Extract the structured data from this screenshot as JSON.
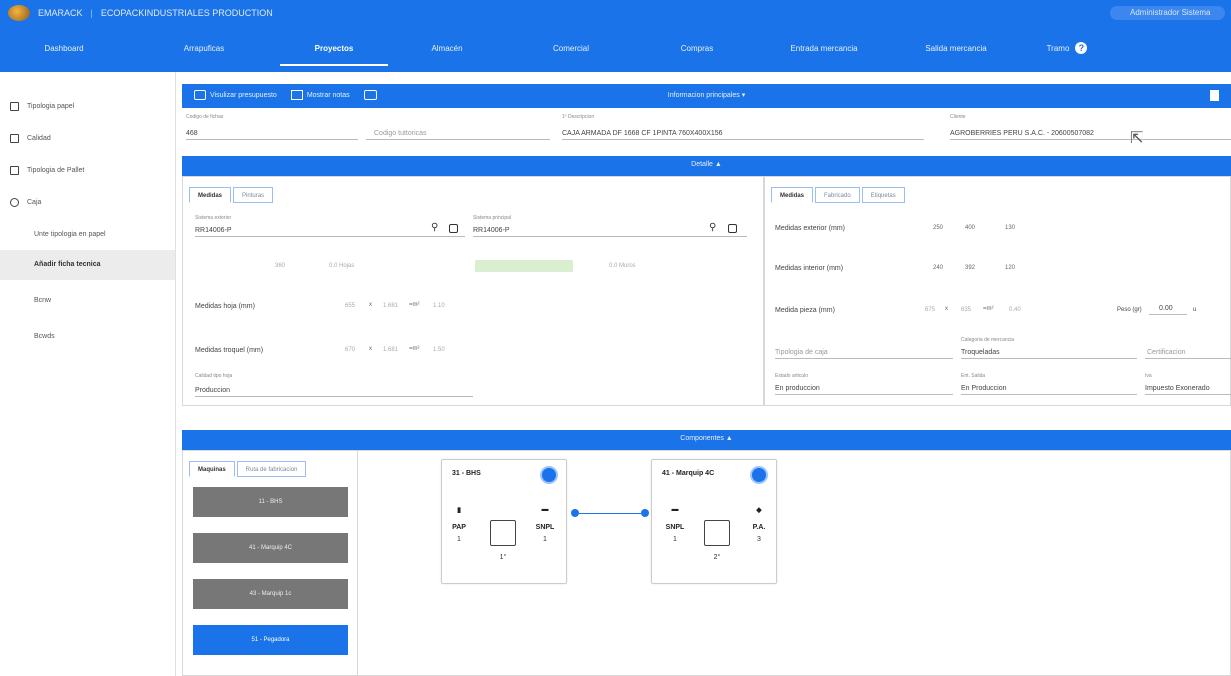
{
  "app": {
    "brand_text": "EMARACK",
    "brand_sub": "ECOPACKINDUSTRIALES PRODUCTION",
    "user_label": "Administrador Sistema"
  },
  "nav": {
    "items": [
      {
        "label": "Dashboard",
        "active": false
      },
      {
        "label": "Arrapuficas",
        "active": false
      },
      {
        "label": "Proyectos",
        "active": true
      },
      {
        "label": "Almacén",
        "active": false
      },
      {
        "label": "Comercial",
        "active": false
      },
      {
        "label": "Compras",
        "active": false
      },
      {
        "label": "Entrada mercancia",
        "active": false
      },
      {
        "label": "Salida mercancia",
        "active": false
      },
      {
        "label": "Tramo",
        "active": false
      }
    ]
  },
  "sidebar": {
    "items": [
      {
        "label": "Tipologia papel",
        "icon": "square-icon"
      },
      {
        "label": "Calidad",
        "icon": "grid-icon"
      },
      {
        "label": "Tipologia de Pallet",
        "icon": "list-icon"
      },
      {
        "label": "Caja",
        "icon": "gear-icon"
      }
    ],
    "subitems": [
      {
        "label": "Unte tipologia en papel",
        "active": false
      },
      {
        "label": "Añadir ficha tecnica",
        "active": true
      },
      {
        "label": "Bcnw",
        "active": false
      },
      {
        "label": "Bcwds",
        "active": false
      }
    ]
  },
  "header": {
    "visualize_label": "Visulizar presupuesto",
    "save_label": "Mostrar notas",
    "center_label": "Informacion principales ▾"
  },
  "info": {
    "code_label": "Codigo de fichas",
    "code_value": "468",
    "customer_code_placeholder": "Codigo tuttoricas",
    "description_label": "1º Descripcion",
    "description_value": "CAJA ARMADA DF 1668 CF 1PINTA 760X400X156",
    "client_label": "Cliente",
    "client_value": "AGROBERRIES PERU S.A.C. - 20600507082"
  },
  "detail": {
    "title": "Detalle ▲",
    "left_tabs": [
      "Medidas",
      "Pinturas"
    ],
    "right_tabs": [
      "Medidas",
      "Fabricado",
      "Etiquetas"
    ],
    "exterior_label": "Sistema exterior",
    "exterior_value": "RR14006-P",
    "interior_label": "Sistema principal",
    "interior_value": "RR14006-P",
    "small_a": "360",
    "small_b": "0.0 Hojas",
    "small_c": "0.0 Muros",
    "hoja_label": "Medidas hoja (mm)",
    "hoja_a": "655",
    "hoja_b": "1.681",
    "hoja_c": "1.10",
    "troquel_label": "Medidas troquel (mm)",
    "troquel_a": "670",
    "troquel_b": "1.681",
    "troquel_c": "1.50",
    "hoja_calidad_label": "Calidad tipo hoja",
    "hoja_calidad_value": "Produccion",
    "ext_label": "Medidas exterior (mm)",
    "ext_vals": [
      "250",
      "400",
      "130"
    ],
    "int_label": "Medidas interior (mm)",
    "int_vals": [
      "240",
      "392",
      "120"
    ],
    "pieza_label": "Medida pieza (mm)",
    "pieza_vals": [
      "675",
      "635",
      "0.40"
    ],
    "peso_label": "Peso (gr)",
    "peso_value": "0.00",
    "peso_unit": "u",
    "tipologia_placeholder": "Tipologia de caja",
    "categoria_label": "Categoria de mercancia",
    "categoria_value": "Troqueladas",
    "certificacion_placeholder": "Certificacion",
    "estado_label": "Estado articulo",
    "estado_value": "En produccion",
    "ent_label": "Ent. Salida",
    "ent_value": "En Produccion",
    "iva_label": "Iva",
    "iva_value": "Impuesto Exonerado"
  },
  "components": {
    "title": "Componentes ▲",
    "tabs": [
      "Maquinas",
      "Ruta de fabricacion"
    ],
    "buttons": [
      {
        "label": "11 - BHS",
        "active": false
      },
      {
        "label": "41 - Marquip 4C",
        "active": false
      },
      {
        "label": "43 - Marquip 1c",
        "active": false
      },
      {
        "label": "51 - Pegadora",
        "active": true
      }
    ],
    "cards": [
      {
        "title": "31 - BHS",
        "left_label": "PAP",
        "left_num": "1",
        "right_label": "SNPL",
        "right_num": "1",
        "center_num": "1°"
      },
      {
        "title": "41 - Marquip 4C",
        "left_label": "SNPL",
        "left_num": "1",
        "right_label": "P.A.",
        "right_num": "3",
        "center_num": "2°"
      }
    ]
  },
  "colors": {
    "primary": "#1a73e8",
    "button_gray": "#777777"
  }
}
